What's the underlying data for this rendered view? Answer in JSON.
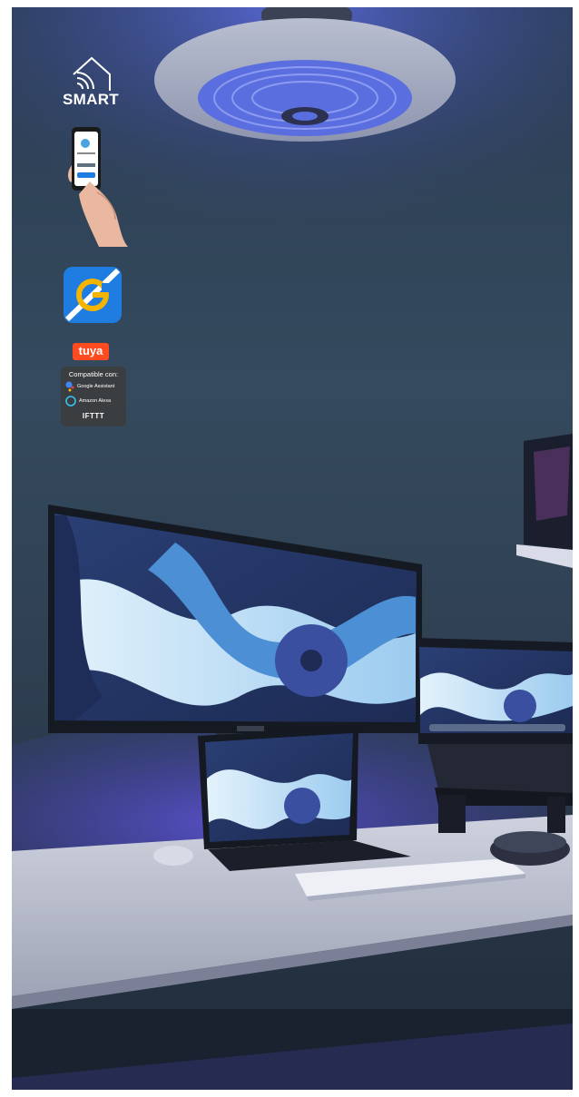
{
  "badges": {
    "smart_label": "SMART",
    "tuya_label": "tuya",
    "compat_title": "Compatible con:",
    "google_label": "Google Assistant",
    "alexa_label": "Amazon Alexa",
    "ifttt_label": "IFTTT"
  },
  "icons": [
    "smart-home-wifi-icon",
    "phone-app-icon",
    "g-app-icon",
    "tuya-logo",
    "google-assistant-icon",
    "amazon-alexa-icon"
  ],
  "colors": {
    "wall": "#2f4052",
    "ceiling_glow": "#4a5fd8",
    "fan_blue": "#5a6ee0",
    "tuya_orange": "#ff4b1f",
    "g_app_blue": "#1f7ce0",
    "g_app_yellow": "#f4b400",
    "screen_light": "#b9dcf2",
    "screen_mid": "#3e84c9",
    "screen_dark": "#26355f",
    "desk": "#c9ccd6"
  }
}
